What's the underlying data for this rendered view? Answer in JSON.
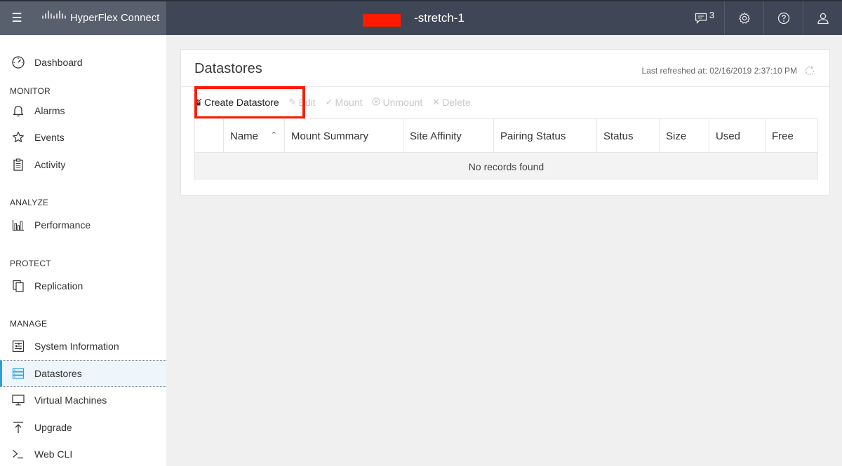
{
  "app": {
    "brand_name": "HyperFlex Connect",
    "cluster_name": "-stretch-1",
    "message_count": "3"
  },
  "sidebar": {
    "dashboard": "Dashboard",
    "sections": {
      "monitor": "MONITOR",
      "analyze": "ANALYZE",
      "protect": "PROTECT",
      "manage": "MANAGE"
    },
    "items": {
      "alarms": "Alarms",
      "events": "Events",
      "activity": "Activity",
      "performance": "Performance",
      "replication": "Replication",
      "system_information": "System Information",
      "datastores": "Datastores",
      "virtual_machines": "Virtual Machines",
      "upgrade": "Upgrade",
      "web_cli": "Web CLI"
    }
  },
  "main": {
    "title": "Datastores",
    "last_refreshed": "Last refreshed at: 02/16/2019 2:37:10 PM",
    "toolbar": {
      "create": "Create Datastore",
      "edit": "Edit",
      "mount": "Mount",
      "unmount": "Unmount",
      "delete": "Delete"
    },
    "table": {
      "columns": [
        "Name",
        "Mount Summary",
        "Site Affinity",
        "Pairing Status",
        "Status",
        "Size",
        "Used",
        "Free"
      ],
      "empty_message": "No records found"
    }
  },
  "colors": {
    "topbar": "#3f4756",
    "brand_block": "#58606e",
    "active_accent": "#2ca0d8",
    "highlight": "#ff1a00"
  }
}
